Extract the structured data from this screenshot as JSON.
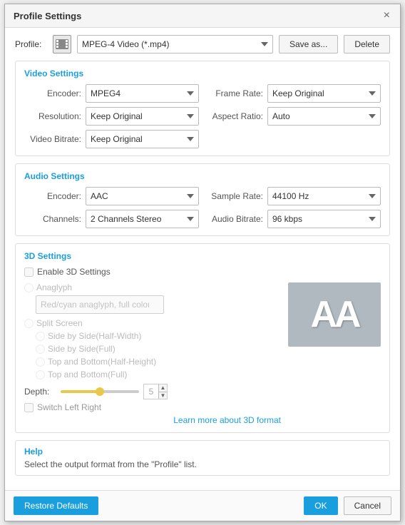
{
  "dialog": {
    "title": "Profile Settings",
    "close_label": "×"
  },
  "profile": {
    "label": "Profile:",
    "value": "MPEG-4 Video (*.mp4)",
    "save_as_label": "Save as...",
    "delete_label": "Delete"
  },
  "video_settings": {
    "section_title": "Video Settings",
    "encoder_label": "Encoder:",
    "encoder_value": "MPEG4",
    "frame_rate_label": "Frame Rate:",
    "frame_rate_value": "Keep Original",
    "resolution_label": "Resolution:",
    "resolution_value": "Keep Original",
    "aspect_ratio_label": "Aspect Ratio:",
    "aspect_ratio_value": "Auto",
    "video_bitrate_label": "Video Bitrate:",
    "video_bitrate_value": "Keep Original"
  },
  "audio_settings": {
    "section_title": "Audio Settings",
    "encoder_label": "Encoder:",
    "encoder_value": "AAC",
    "sample_rate_label": "Sample Rate:",
    "sample_rate_value": "44100 Hz",
    "channels_label": "Channels:",
    "channels_value": "2 Channels Stereo",
    "audio_bitrate_label": "Audio Bitrate:",
    "audio_bitrate_value": "96 kbps"
  },
  "threed_settings": {
    "section_title": "3D Settings",
    "enable_label": "Enable 3D Settings",
    "anaglyph_label": "Anaglyph",
    "anaglyph_option": "Red/cyan anaglyph, full color",
    "split_screen_label": "Split Screen",
    "side_by_side_half_label": "Side by Side(Half-Width)",
    "side_by_side_full_label": "Side by Side(Full)",
    "top_bottom_half_label": "Top and Bottom(Half-Height)",
    "top_bottom_full_label": "Top and Bottom(Full)",
    "depth_label": "Depth:",
    "depth_value": "5",
    "switch_label": "Switch Left Right",
    "learn_more_label": "Learn more about 3D format",
    "aa_preview": "AA"
  },
  "help": {
    "section_title": "Help",
    "help_text": "Select the output format from the \"Profile\" list."
  },
  "footer": {
    "restore_defaults_label": "Restore Defaults",
    "ok_label": "OK",
    "cancel_label": "Cancel"
  }
}
